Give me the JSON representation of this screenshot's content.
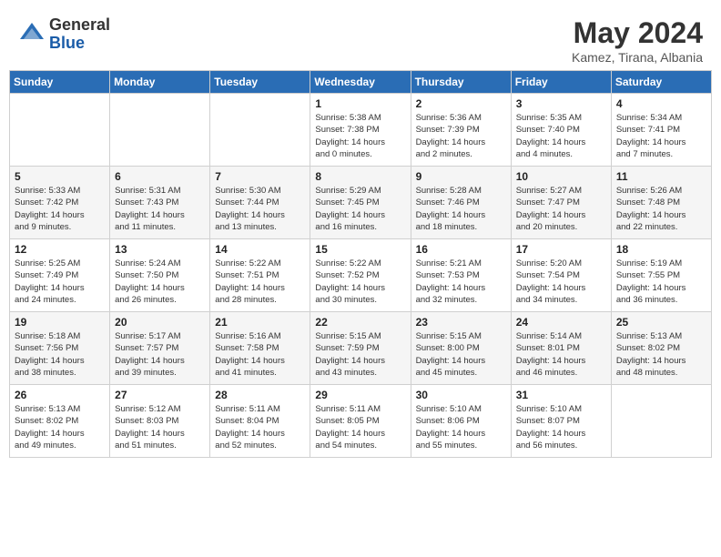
{
  "header": {
    "logo_general": "General",
    "logo_blue": "Blue",
    "month_year": "May 2024",
    "location": "Kamez, Tirana, Albania"
  },
  "days_of_week": [
    "Sunday",
    "Monday",
    "Tuesday",
    "Wednesday",
    "Thursday",
    "Friday",
    "Saturday"
  ],
  "weeks": [
    [
      {
        "day": "",
        "info": ""
      },
      {
        "day": "",
        "info": ""
      },
      {
        "day": "",
        "info": ""
      },
      {
        "day": "1",
        "info": "Sunrise: 5:38 AM\nSunset: 7:38 PM\nDaylight: 14 hours\nand 0 minutes."
      },
      {
        "day": "2",
        "info": "Sunrise: 5:36 AM\nSunset: 7:39 PM\nDaylight: 14 hours\nand 2 minutes."
      },
      {
        "day": "3",
        "info": "Sunrise: 5:35 AM\nSunset: 7:40 PM\nDaylight: 14 hours\nand 4 minutes."
      },
      {
        "day": "4",
        "info": "Sunrise: 5:34 AM\nSunset: 7:41 PM\nDaylight: 14 hours\nand 7 minutes."
      }
    ],
    [
      {
        "day": "5",
        "info": "Sunrise: 5:33 AM\nSunset: 7:42 PM\nDaylight: 14 hours\nand 9 minutes."
      },
      {
        "day": "6",
        "info": "Sunrise: 5:31 AM\nSunset: 7:43 PM\nDaylight: 14 hours\nand 11 minutes."
      },
      {
        "day": "7",
        "info": "Sunrise: 5:30 AM\nSunset: 7:44 PM\nDaylight: 14 hours\nand 13 minutes."
      },
      {
        "day": "8",
        "info": "Sunrise: 5:29 AM\nSunset: 7:45 PM\nDaylight: 14 hours\nand 16 minutes."
      },
      {
        "day": "9",
        "info": "Sunrise: 5:28 AM\nSunset: 7:46 PM\nDaylight: 14 hours\nand 18 minutes."
      },
      {
        "day": "10",
        "info": "Sunrise: 5:27 AM\nSunset: 7:47 PM\nDaylight: 14 hours\nand 20 minutes."
      },
      {
        "day": "11",
        "info": "Sunrise: 5:26 AM\nSunset: 7:48 PM\nDaylight: 14 hours\nand 22 minutes."
      }
    ],
    [
      {
        "day": "12",
        "info": "Sunrise: 5:25 AM\nSunset: 7:49 PM\nDaylight: 14 hours\nand 24 minutes."
      },
      {
        "day": "13",
        "info": "Sunrise: 5:24 AM\nSunset: 7:50 PM\nDaylight: 14 hours\nand 26 minutes."
      },
      {
        "day": "14",
        "info": "Sunrise: 5:22 AM\nSunset: 7:51 PM\nDaylight: 14 hours\nand 28 minutes."
      },
      {
        "day": "15",
        "info": "Sunrise: 5:22 AM\nSunset: 7:52 PM\nDaylight: 14 hours\nand 30 minutes."
      },
      {
        "day": "16",
        "info": "Sunrise: 5:21 AM\nSunset: 7:53 PM\nDaylight: 14 hours\nand 32 minutes."
      },
      {
        "day": "17",
        "info": "Sunrise: 5:20 AM\nSunset: 7:54 PM\nDaylight: 14 hours\nand 34 minutes."
      },
      {
        "day": "18",
        "info": "Sunrise: 5:19 AM\nSunset: 7:55 PM\nDaylight: 14 hours\nand 36 minutes."
      }
    ],
    [
      {
        "day": "19",
        "info": "Sunrise: 5:18 AM\nSunset: 7:56 PM\nDaylight: 14 hours\nand 38 minutes."
      },
      {
        "day": "20",
        "info": "Sunrise: 5:17 AM\nSunset: 7:57 PM\nDaylight: 14 hours\nand 39 minutes."
      },
      {
        "day": "21",
        "info": "Sunrise: 5:16 AM\nSunset: 7:58 PM\nDaylight: 14 hours\nand 41 minutes."
      },
      {
        "day": "22",
        "info": "Sunrise: 5:15 AM\nSunset: 7:59 PM\nDaylight: 14 hours\nand 43 minutes."
      },
      {
        "day": "23",
        "info": "Sunrise: 5:15 AM\nSunset: 8:00 PM\nDaylight: 14 hours\nand 45 minutes."
      },
      {
        "day": "24",
        "info": "Sunrise: 5:14 AM\nSunset: 8:01 PM\nDaylight: 14 hours\nand 46 minutes."
      },
      {
        "day": "25",
        "info": "Sunrise: 5:13 AM\nSunset: 8:02 PM\nDaylight: 14 hours\nand 48 minutes."
      }
    ],
    [
      {
        "day": "26",
        "info": "Sunrise: 5:13 AM\nSunset: 8:02 PM\nDaylight: 14 hours\nand 49 minutes."
      },
      {
        "day": "27",
        "info": "Sunrise: 5:12 AM\nSunset: 8:03 PM\nDaylight: 14 hours\nand 51 minutes."
      },
      {
        "day": "28",
        "info": "Sunrise: 5:11 AM\nSunset: 8:04 PM\nDaylight: 14 hours\nand 52 minutes."
      },
      {
        "day": "29",
        "info": "Sunrise: 5:11 AM\nSunset: 8:05 PM\nDaylight: 14 hours\nand 54 minutes."
      },
      {
        "day": "30",
        "info": "Sunrise: 5:10 AM\nSunset: 8:06 PM\nDaylight: 14 hours\nand 55 minutes."
      },
      {
        "day": "31",
        "info": "Sunrise: 5:10 AM\nSunset: 8:07 PM\nDaylight: 14 hours\nand 56 minutes."
      },
      {
        "day": "",
        "info": ""
      }
    ]
  ]
}
